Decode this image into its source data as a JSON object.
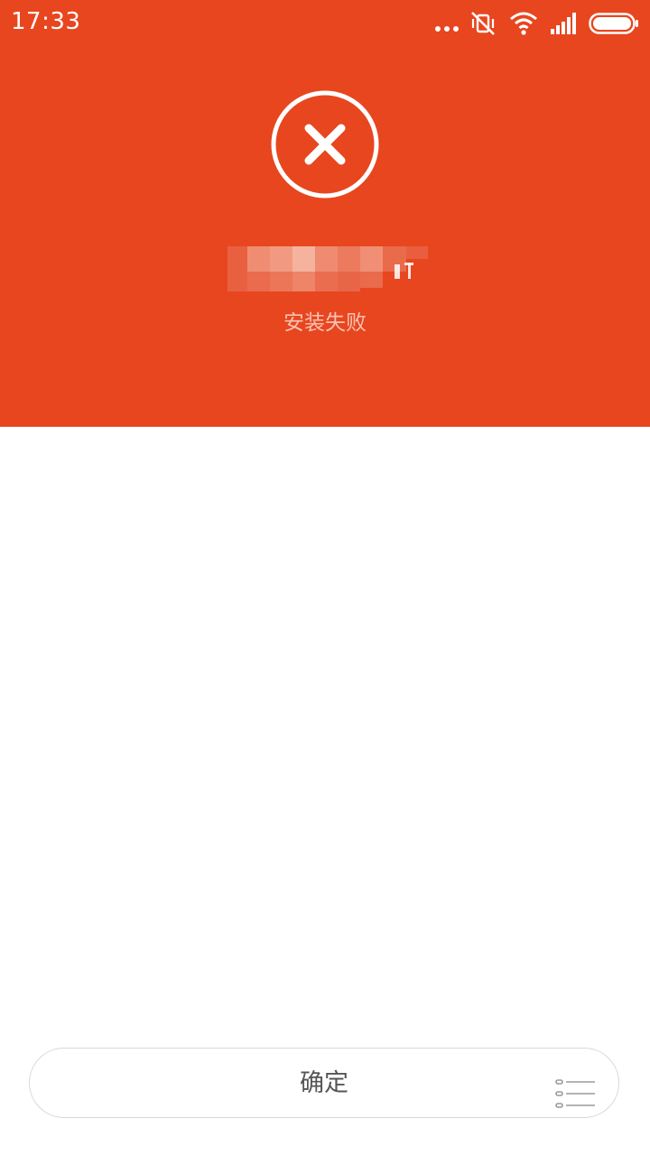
{
  "status_bar": {
    "time": "17:33",
    "icons": [
      "more-dots-icon",
      "vibrate-mute-icon",
      "wifi-icon",
      "signal-icon",
      "battery-icon"
    ]
  },
  "header": {
    "background_color": "#e8461f",
    "status_icon": "close-circle-icon",
    "status_text": "安装失败"
  },
  "footer": {
    "ok_label": "确定",
    "menu_icon": "list-icon"
  }
}
